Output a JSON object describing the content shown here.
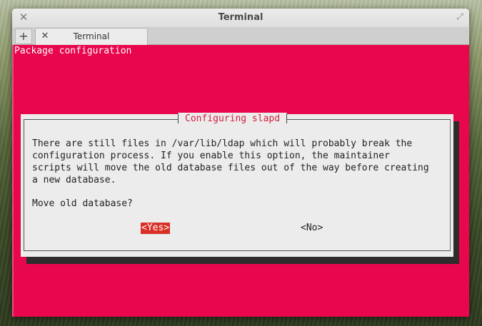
{
  "window": {
    "title": "Terminal",
    "close_icon": "✕",
    "maximize_icon": "⤢"
  },
  "tabbar": {
    "new_tab_icon": "+",
    "tabs": [
      {
        "label": "Terminal",
        "close_icon": "✕"
      }
    ]
  },
  "terminal": {
    "header": "Package configuration",
    "background_color": "#e8064c",
    "dialog": {
      "title": "Configuring slapd",
      "message": "There are still files in /var/lib/ldap which will probably break the\nconfiguration process. If you enable this option, the maintainer\nscripts will move the old database files out of the way before creating\na new database.",
      "question": "Move old database?",
      "buttons": {
        "yes": "<Yes>",
        "no": "<No>"
      },
      "selected_button": "yes",
      "accent_color": "#d93025"
    }
  }
}
